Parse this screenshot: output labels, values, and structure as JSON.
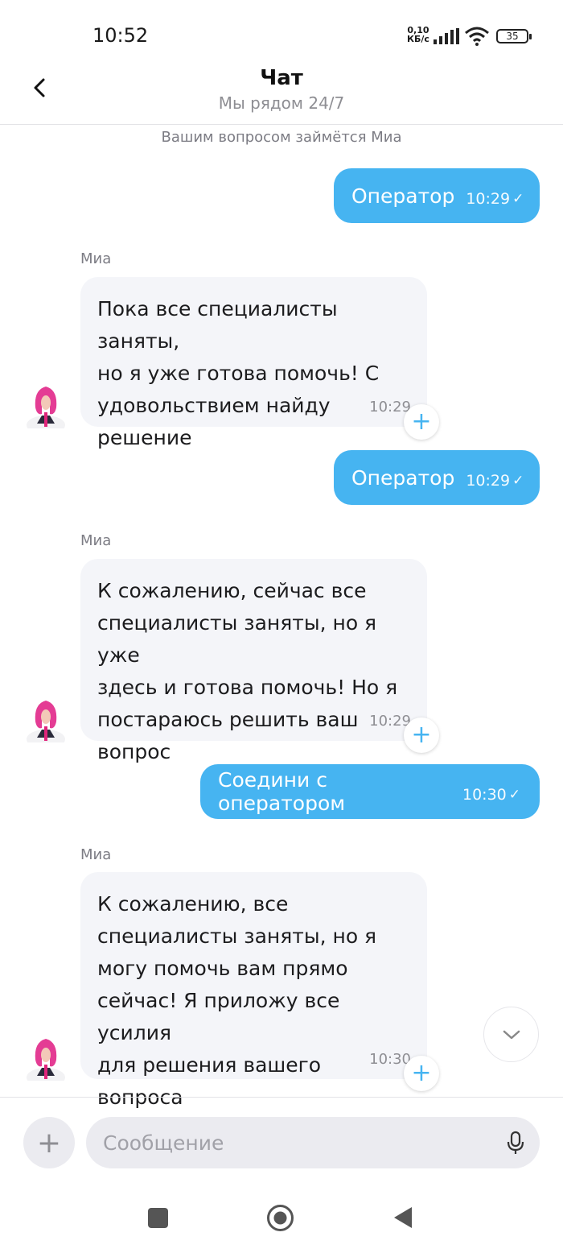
{
  "status_bar": {
    "time": "10:52",
    "net_speed_value": "0,10",
    "net_speed_unit": "КБ/с",
    "battery": "35"
  },
  "header": {
    "title": "Чат",
    "subtitle": "Мы рядом 24/7"
  },
  "chat": {
    "notice": "Вашим вопросом займётся Миа",
    "messages": [
      {
        "text": "Оператор",
        "time": "10:29"
      },
      {
        "sender": "Миа",
        "text": "Пока все специалисты заняты,\nно я уже готова помочь! С\nудовольствием найду\nрешение",
        "time": "10:29"
      },
      {
        "text": "Оператор",
        "time": "10:29"
      },
      {
        "sender": "Миа",
        "text": "К сожалению, сейчас все\nспециалисты заняты, но я уже\nздесь и готова помочь! Но я\nпостараюсь решить ваш\nвопрос",
        "time": "10:29"
      },
      {
        "text": "Соедини с оператором",
        "time": "10:30"
      },
      {
        "sender": "Миа",
        "text": "К сожалению, все\nспециалисты заняты, но я\nмогу помочь вам прямо\nсейчас! Я приложу все усилия\nдля решения вашего вопроса",
        "time": "10:30"
      }
    ]
  },
  "composer": {
    "placeholder": "Сообщение"
  },
  "icons": {
    "back": "back-arrow-icon",
    "read": "check-icon",
    "reaction": "plus-icon",
    "scroll": "chevron-down-icon",
    "attach": "plus-icon",
    "mic": "microphone-icon"
  },
  "colors": {
    "outgoing_bubble": "#46b4f1",
    "incoming_bubble": "#f4f5f9",
    "accent": "#46b4f1"
  }
}
